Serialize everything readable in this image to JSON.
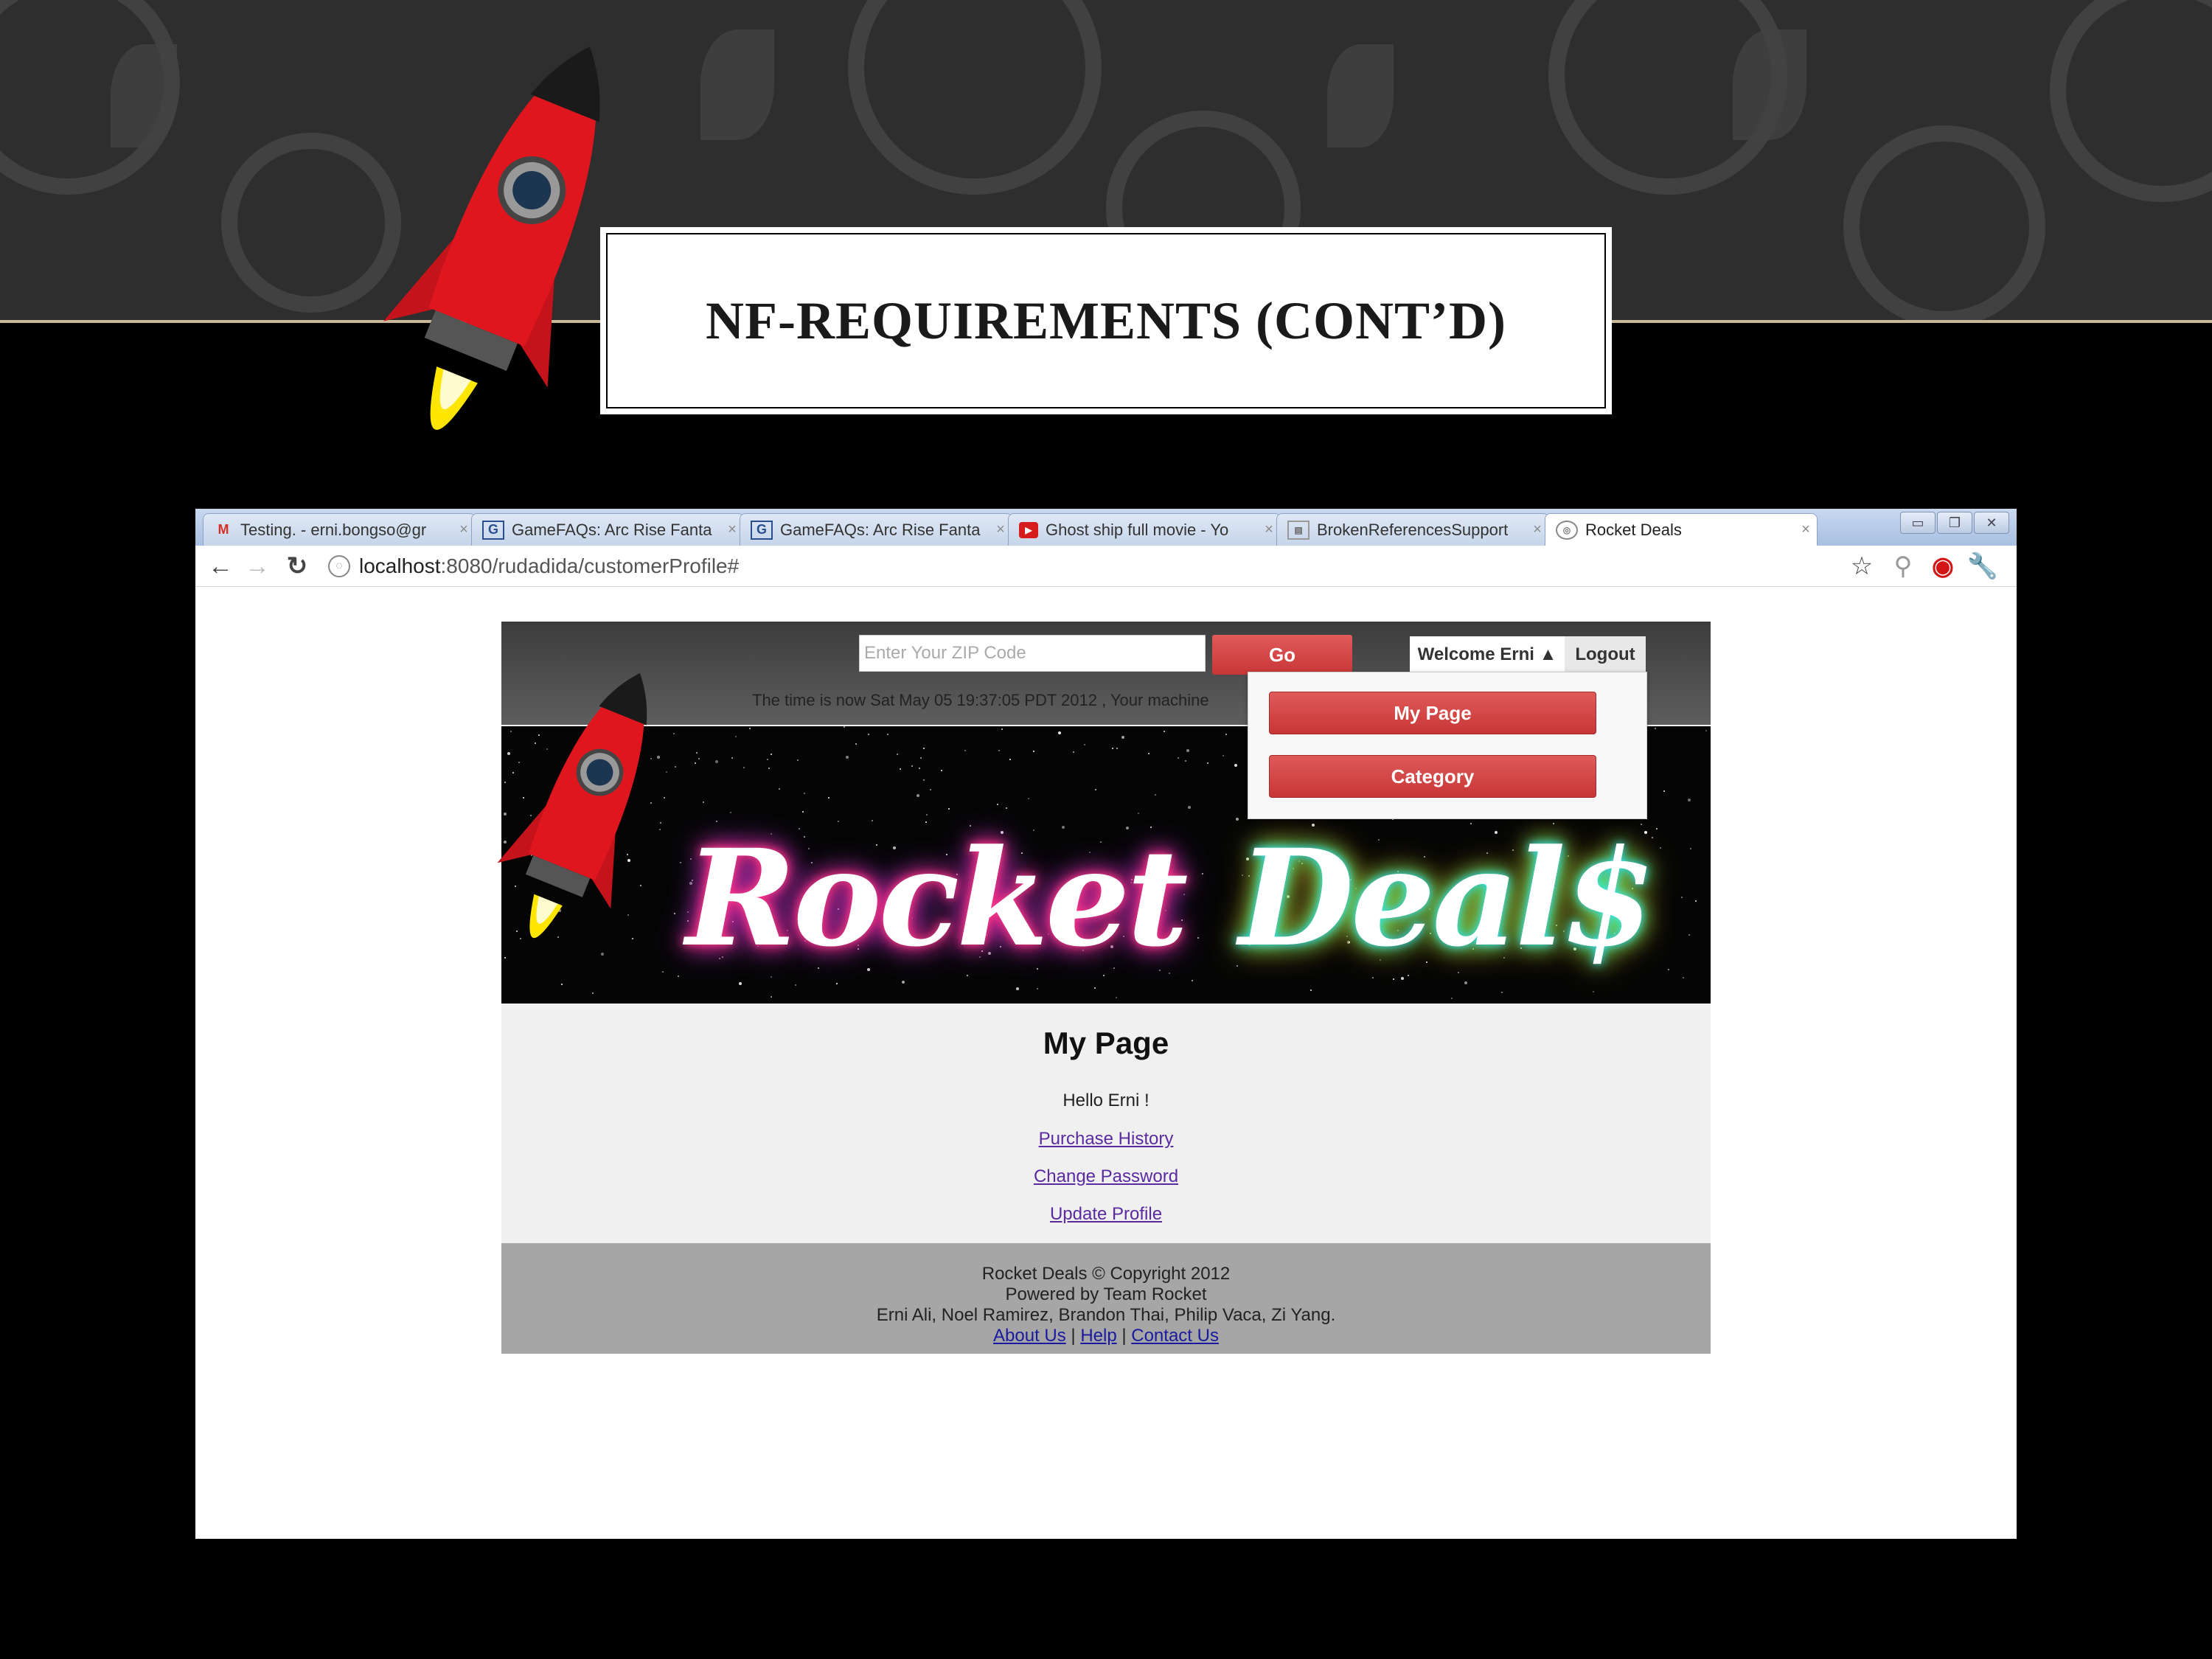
{
  "slide": {
    "title": "NF-REQUIREMENTS (CONT’D)"
  },
  "browser": {
    "tabs": [
      {
        "label": "Testing. - erni.bongso@gr",
        "icon": "gmail-icon"
      },
      {
        "label": "GameFAQs: Arc Rise Fanta",
        "icon": "gamefaqs-icon"
      },
      {
        "label": "GameFAQs: Arc Rise Fanta",
        "icon": "gamefaqs-icon"
      },
      {
        "label": "Ghost ship full movie - Yo",
        "icon": "youtube-icon"
      },
      {
        "label": "BrokenReferencesSupport",
        "icon": "page-icon"
      },
      {
        "label": "Rocket Deals",
        "icon": "globe-icon"
      }
    ],
    "tab_close": "×",
    "window_controls": [
      "▭",
      "❐",
      "✕"
    ],
    "url_host": "localhost",
    "url_rest": ":8080/rudadida/customerProfile#"
  },
  "site": {
    "zip_placeholder": "Enter Your ZIP Code",
    "go_label": "Go",
    "welcome_label": "Welcome Erni ▲",
    "logout_label": "Logout",
    "time_text": "The time is now Sat May 05 19:37:05 PDT 2012 , Your machine",
    "banner_word_1": "Rocket",
    "banner_word_2": "Deal$",
    "dropdown": {
      "my_page": "My Page",
      "category": "Category"
    },
    "content": {
      "heading": "My Page",
      "hello": "Hello Erni !",
      "links": [
        "Purchase History",
        "Change Password",
        "Update Profile"
      ]
    },
    "footer": {
      "copyright": "Rocket Deals © Copyright 2012",
      "powered": "Powered by Team Rocket",
      "authors": "Erni Ali, Noel Ramirez, Brandon Thai, Philip Vaca, Zi Yang.",
      "about": "About Us",
      "help": "Help",
      "contact": "Contact Us",
      "separator": "|"
    }
  },
  "colors": {
    "accent_red": "#d04444",
    "slide_bg": "#000000",
    "footer_bg": "#a6a6a6"
  }
}
